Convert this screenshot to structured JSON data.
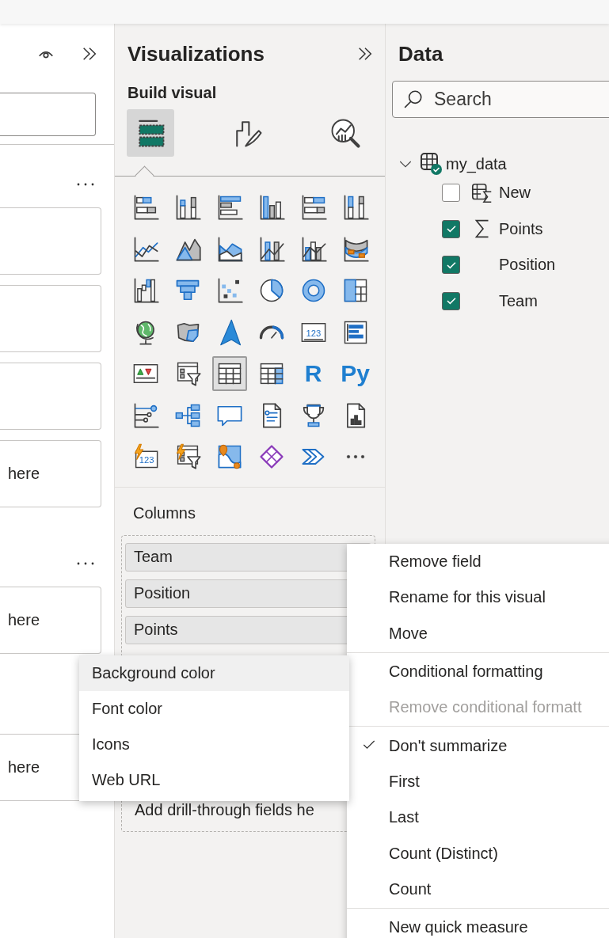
{
  "filters_pane": {
    "sections": [
      {
        "wells": [
          {
            "kind": "empty"
          },
          {
            "kind": "empty"
          },
          {
            "kind": "empty"
          },
          {
            "kind": "hint",
            "text": "here"
          }
        ]
      },
      {
        "wells": [
          {
            "kind": "hint",
            "text": "here"
          },
          {
            "kind": "hint",
            "text": "here"
          }
        ]
      }
    ]
  },
  "visualizations": {
    "title": "Visualizations",
    "subtitle": "Build visual",
    "tabs": [
      {
        "kind": "fields",
        "selected": true
      },
      {
        "kind": "format",
        "selected": false
      },
      {
        "kind": "analytics",
        "selected": false
      }
    ],
    "visual_types": [
      {
        "kind": "stacked_bar",
        "selected": false
      },
      {
        "kind": "stacked_column",
        "selected": false
      },
      {
        "kind": "clustered_bar",
        "selected": false
      },
      {
        "kind": "clustered_column",
        "selected": false
      },
      {
        "kind": "hundred_bar",
        "selected": false
      },
      {
        "kind": "hundred_column",
        "selected": false
      },
      {
        "kind": "line",
        "selected": false
      },
      {
        "kind": "area",
        "selected": false
      },
      {
        "kind": "stacked_area",
        "selected": false
      },
      {
        "kind": "line_column",
        "selected": false
      },
      {
        "kind": "line_clustered",
        "selected": false
      },
      {
        "kind": "ribbon",
        "selected": false
      },
      {
        "kind": "waterfall",
        "selected": false
      },
      {
        "kind": "funnel",
        "selected": false
      },
      {
        "kind": "scatter",
        "selected": false
      },
      {
        "kind": "pie",
        "selected": false
      },
      {
        "kind": "donut",
        "selected": false
      },
      {
        "kind": "treemap",
        "selected": false
      },
      {
        "kind": "globe",
        "selected": false
      },
      {
        "kind": "filled_map",
        "selected": false
      },
      {
        "kind": "arrow_map",
        "selected": false
      },
      {
        "kind": "gauge",
        "selected": false
      },
      {
        "kind": "card",
        "selected": false,
        "text": "123"
      },
      {
        "kind": "multi_row_card",
        "selected": false
      },
      {
        "kind": "kpi",
        "selected": false
      },
      {
        "kind": "slicer",
        "selected": false
      },
      {
        "kind": "table",
        "selected": true
      },
      {
        "kind": "matrix",
        "selected": false
      },
      {
        "kind": "script",
        "selected": false,
        "text": "R"
      },
      {
        "kind": "script",
        "selected": false,
        "text": "Py"
      },
      {
        "kind": "key_influencers",
        "selected": false
      },
      {
        "kind": "decomposition",
        "selected": false
      },
      {
        "kind": "qa",
        "selected": false
      },
      {
        "kind": "narrative",
        "selected": false
      },
      {
        "kind": "trophy",
        "selected": false
      },
      {
        "kind": "paginated",
        "selected": false
      },
      {
        "kind": "power_card",
        "selected": false,
        "text": "123"
      },
      {
        "kind": "power_slicer",
        "selected": false
      },
      {
        "kind": "azure_map",
        "selected": false
      },
      {
        "kind": "power_apps",
        "selected": false
      },
      {
        "kind": "power_automate",
        "selected": false
      },
      {
        "kind": "more",
        "selected": false
      }
    ],
    "columns": {
      "label": "Columns",
      "fields": [
        {
          "name": "Team"
        },
        {
          "name": "Position"
        },
        {
          "name": "Points"
        }
      ]
    },
    "drill_through": {
      "hint": "Add drill-through fields he"
    }
  },
  "data": {
    "title": "Data",
    "search": {
      "placeholder": "Search"
    },
    "tables": [
      {
        "name": "my_data",
        "expanded": true,
        "children": [
          {
            "name": "New",
            "kind": "calculated",
            "checked": false
          },
          {
            "name": "Points",
            "kind": "measure",
            "checked": true
          },
          {
            "name": "Position",
            "kind": "plain",
            "checked": true
          },
          {
            "name": "Team",
            "kind": "plain",
            "checked": true
          }
        ]
      }
    ]
  },
  "context_menu": {
    "groups": [
      {
        "items": [
          {
            "label": "Remove field",
            "checked": false,
            "disabled": false
          },
          {
            "label": "Rename for this visual",
            "checked": false,
            "disabled": false
          },
          {
            "label": "Move",
            "checked": false,
            "disabled": false
          }
        ]
      },
      {
        "items": [
          {
            "label": "Conditional formatting",
            "checked": false,
            "disabled": false
          },
          {
            "label": "Remove conditional formatt",
            "checked": false,
            "disabled": true
          }
        ]
      },
      {
        "items": [
          {
            "label": "Don't summarize",
            "checked": true,
            "disabled": false
          },
          {
            "label": "First",
            "checked": false,
            "disabled": false
          },
          {
            "label": "Last",
            "checked": false,
            "disabled": false
          },
          {
            "label": "Count (Distinct)",
            "checked": false,
            "disabled": false
          },
          {
            "label": "Count",
            "checked": false,
            "disabled": false
          }
        ]
      },
      {
        "items": [
          {
            "label": "New quick measure",
            "checked": false,
            "disabled": false
          }
        ]
      }
    ]
  },
  "submenu": {
    "items": [
      {
        "label": "Background color",
        "hovered": true
      },
      {
        "label": "Font color",
        "hovered": false
      },
      {
        "label": "Icons",
        "hovered": false
      },
      {
        "label": "Web URL",
        "hovered": false
      }
    ]
  }
}
